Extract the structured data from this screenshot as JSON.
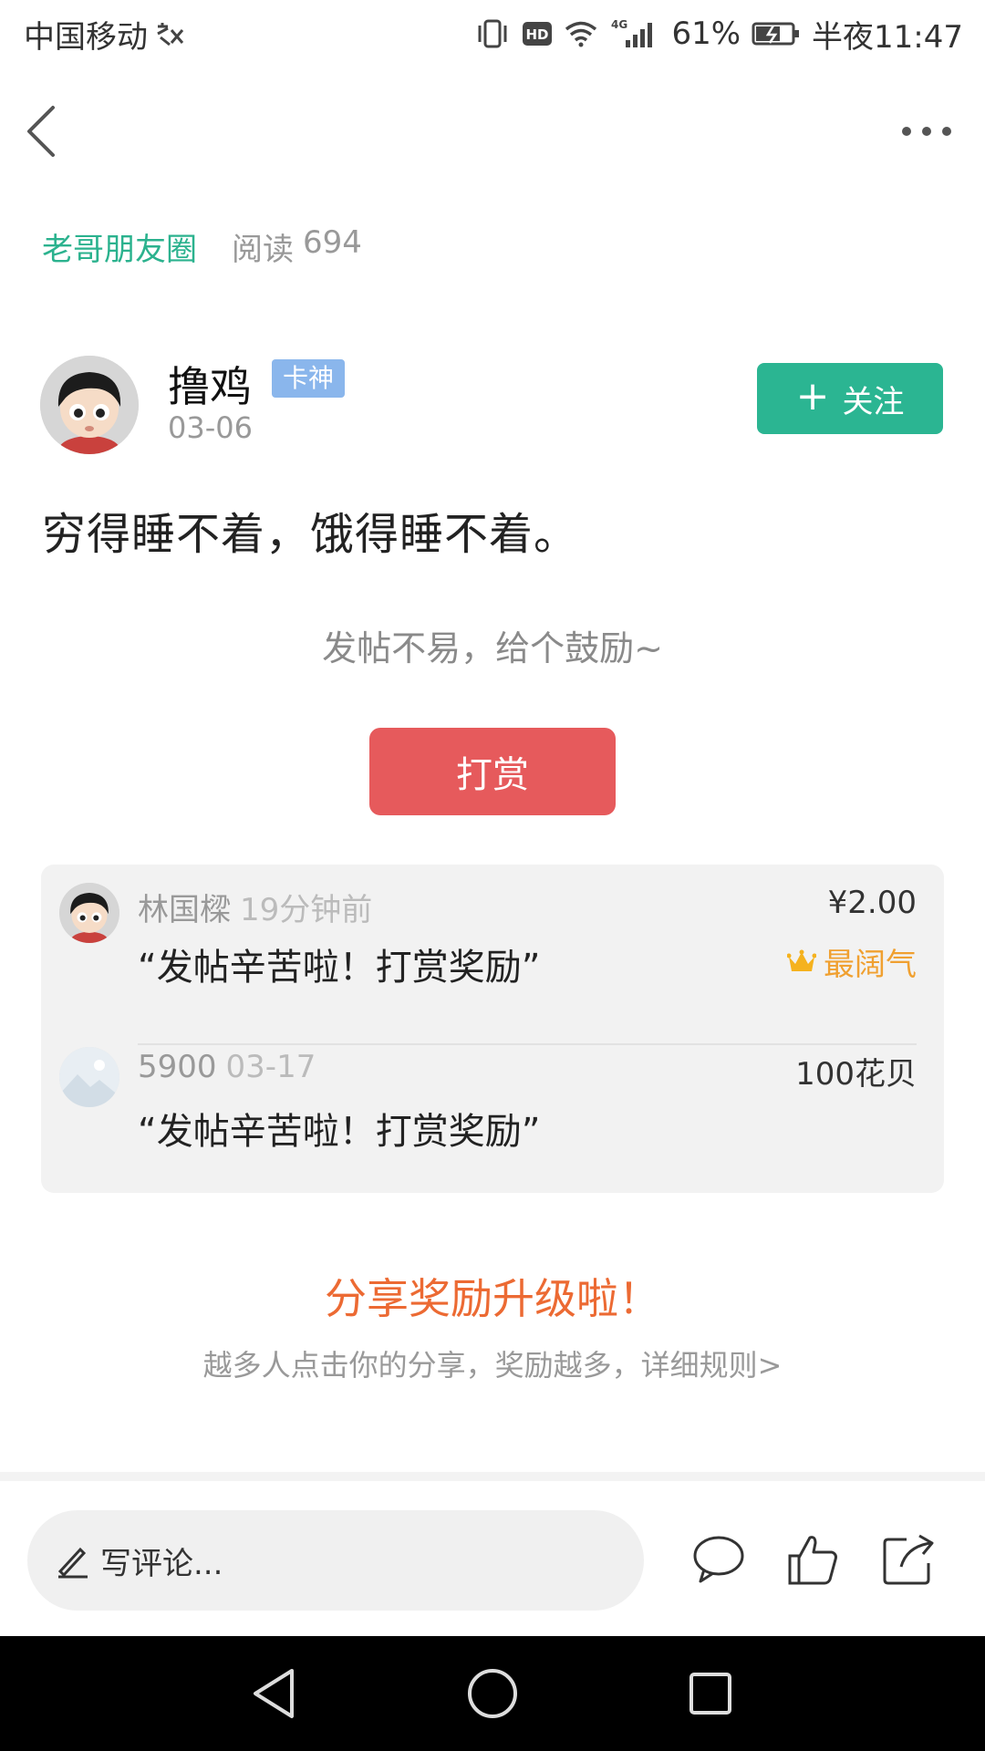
{
  "status_bar": {
    "carrier": "中国移动",
    "network": "4G",
    "battery": "61%",
    "time": "半夜11:47"
  },
  "circle": {
    "name": "老哥朋友圈",
    "read_label": "阅读",
    "read_count": "694"
  },
  "author": {
    "name": "撸鸡",
    "badge": "卡神",
    "date": "03-06",
    "follow_label": "关注"
  },
  "post": {
    "content": "穷得睡不着，饿得睡不着。"
  },
  "reward": {
    "prompt": "发帖不易，给个鼓励~",
    "button_label": "打赏",
    "items": [
      {
        "name": "林国樑",
        "time": "19分钟前",
        "message": "“发帖辛苦啦！打赏奖励”",
        "amount": "¥2.00",
        "rank_label": "最阔气"
      },
      {
        "name": "5900",
        "time": "03-17",
        "message": "“发帖辛苦啦！打赏奖励”",
        "amount": "100花贝"
      }
    ]
  },
  "share_promo": {
    "title": "分享奖励升级啦！",
    "description": "越多人点击你的分享，奖励越多，详细规则>"
  },
  "comment_bar": {
    "placeholder": "写评论..."
  },
  "colors": {
    "accent_green": "#2bb592",
    "reward_red": "#e65a5c",
    "promo_orange": "#ec6a33",
    "badge_blue": "#8ab6ec",
    "rank_gold": "#f0a030"
  }
}
